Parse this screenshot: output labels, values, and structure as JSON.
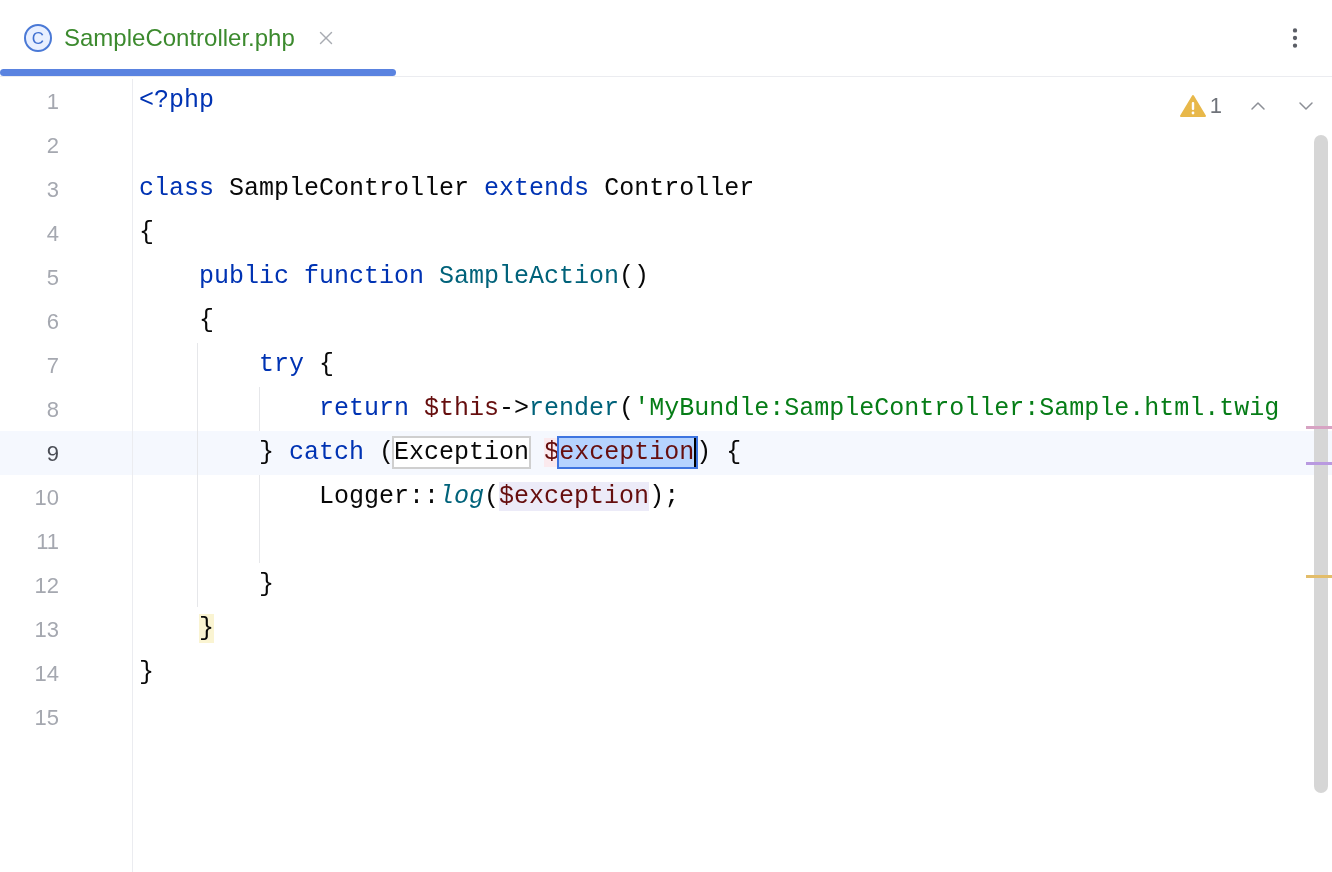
{
  "tab": {
    "label": "SampleController.php",
    "icon_text": "C",
    "selected": true
  },
  "inspections": {
    "warning_count": "1"
  },
  "lines": [
    {
      "number": "1",
      "current": false,
      "tokens": [
        {
          "text": "<?php",
          "kind": "plain",
          "color": "#0033b3"
        }
      ]
    },
    {
      "number": "2",
      "current": false
    },
    {
      "number": "3",
      "current": false,
      "tokens": [
        {
          "text": "class",
          "kind": "plain",
          "color": "#0033b3"
        },
        {
          "text": " SampleController ",
          "kind": "plain",
          "color": "#080808"
        },
        {
          "text": "extends",
          "kind": "plain",
          "color": "#0033b3"
        },
        {
          "text": " Controller",
          "kind": "plain",
          "color": "#080808"
        }
      ]
    },
    {
      "number": "4",
      "current": false,
      "tokens": [
        {
          "text": "{",
          "kind": "plain",
          "color": "#080808"
        }
      ]
    },
    {
      "number": "5",
      "current": false,
      "tokens": [
        {
          "text": "    public function",
          "kind": "plain",
          "color": "#0033b3"
        },
        {
          "text": " SampleAction",
          "kind": "plain",
          "color": "#00627a"
        },
        {
          "text": "()",
          "kind": "plain",
          "color": "#080808"
        }
      ]
    },
    {
      "number": "6",
      "current": false,
      "tokens": [
        {
          "text": "    {",
          "kind": "plain",
          "color": "#080808"
        }
      ]
    },
    {
      "number": "7",
      "current": false,
      "tokens": [
        {
          "text": "        try",
          "kind": "plain",
          "color": "#0033b3"
        },
        {
          "text": " {",
          "kind": "plain",
          "color": "#080808"
        }
      ]
    },
    {
      "number": "8",
      "current": false,
      "tokens": [
        {
          "text": "            return",
          "kind": "plain",
          "color": "#0033b3"
        },
        {
          "text": " $this",
          "kind": "plain",
          "color": "#660e0e"
        },
        {
          "text": "->",
          "kind": "plain",
          "color": "#080808"
        },
        {
          "text": "render",
          "kind": "plain",
          "color": "#00627a"
        },
        {
          "text": "(",
          "kind": "plain",
          "color": "#080808"
        },
        {
          "text": "'MyBundle:SampleController:Sample.html.twig",
          "kind": "plain",
          "color": "#067d17"
        }
      ]
    },
    {
      "number": "9",
      "current": true,
      "tokens": [
        {
          "text": "        } ",
          "kind": "plain",
          "color": "#080808"
        },
        {
          "text": "catch",
          "kind": "plain",
          "color": "#0033b3"
        },
        {
          "text": " (",
          "kind": "plain",
          "color": "#080808"
        },
        {
          "text": "Exception",
          "kind": "template",
          "color": "#080808"
        },
        {
          "text": " $",
          "kind": "write",
          "color": "#660e0e"
        },
        {
          "text": "exception",
          "kind": "selection",
          "color": "#660e0e"
        },
        {
          "text": ") {",
          "kind": "plain",
          "color": "#080808"
        }
      ]
    },
    {
      "number": "10",
      "current": false,
      "tokens": [
        {
          "text": "            Logger::",
          "kind": "plain",
          "color": "#080808"
        },
        {
          "text": "log",
          "kind": "italic",
          "color": "#00627a"
        },
        {
          "text": "(",
          "kind": "plain",
          "color": "#080808"
        },
        {
          "text": "$exception",
          "kind": "usage",
          "color": "#660e0e"
        },
        {
          "text": ");",
          "kind": "plain",
          "color": "#080808"
        }
      ]
    },
    {
      "number": "11",
      "current": false
    },
    {
      "number": "12",
      "current": false,
      "tokens": [
        {
          "text": "        }",
          "kind": "plain",
          "color": "#080808"
        }
      ]
    },
    {
      "number": "13",
      "current": false,
      "tokens": [
        {
          "text": "    }",
          "kind": "brace",
          "color": "#080808"
        }
      ]
    },
    {
      "number": "14",
      "current": false,
      "tokens": [
        {
          "text": "}",
          "kind": "plain",
          "color": "#080808"
        }
      ]
    },
    {
      "number": "15",
      "current": false
    }
  ]
}
